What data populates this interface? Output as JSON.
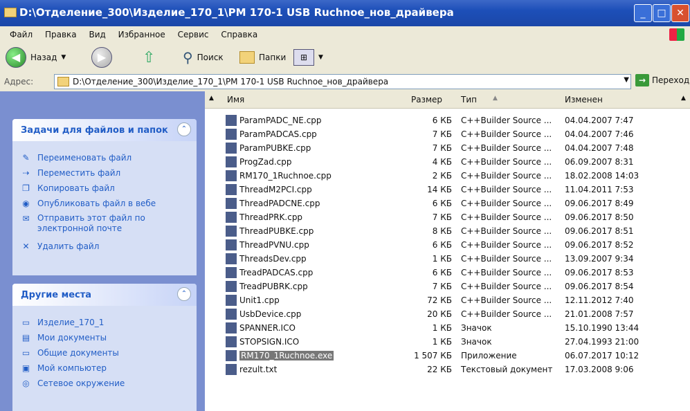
{
  "window": {
    "title": "D:\\Отделение_300\\Изделие_170_1\\РМ 170-1 USB Ruchnoe_нов_драйвера"
  },
  "menu": [
    "Файл",
    "Правка",
    "Вид",
    "Избранное",
    "Сервис",
    "Справка"
  ],
  "toolbar": {
    "back": "Назад",
    "search": "Поиск",
    "folders": "Папки"
  },
  "address": {
    "label": "Адрес:",
    "value": "D:\\Отделение_300\\Изделие_170_1\\РМ 170-1 USB Ruchnoe_нов_драйвера",
    "go": "Переход"
  },
  "tasks": {
    "title": "Задачи для файлов и папок",
    "items": [
      "Переименовать файл",
      "Переместить файл",
      "Копировать файл",
      "Опубликовать файл в вебе",
      "Отправить этот файл по электронной почте",
      "Удалить файл"
    ]
  },
  "places": {
    "title": "Другие места",
    "items": [
      "Изделие_170_1",
      "Мои документы",
      "Общие документы",
      "Мой компьютер",
      "Сетевое окружение"
    ]
  },
  "columns": {
    "name": "Имя",
    "size": "Размер",
    "type": "Тип",
    "modified": "Изменен"
  },
  "files": [
    {
      "name": "ParamPADC_NE.cpp",
      "size": "6 КБ",
      "type": "C++Builder Source ...",
      "modified": "04.04.2007 7:47"
    },
    {
      "name": "ParamPADCAS.cpp",
      "size": "7 КБ",
      "type": "C++Builder Source ...",
      "modified": "04.04.2007 7:46"
    },
    {
      "name": "ParamPUBKE.cpp",
      "size": "7 КБ",
      "type": "C++Builder Source ...",
      "modified": "04.04.2007 7:48"
    },
    {
      "name": "ProgZad.cpp",
      "size": "4 КБ",
      "type": "C++Builder Source ...",
      "modified": "06.09.2007 8:31"
    },
    {
      "name": "RM170_1Ruchnoe.cpp",
      "size": "2 КБ",
      "type": "C++Builder Source ...",
      "modified": "18.02.2008 14:03"
    },
    {
      "name": "ThreadM2PCI.cpp",
      "size": "14 КБ",
      "type": "C++Builder Source ...",
      "modified": "11.04.2011 7:53"
    },
    {
      "name": "ThreadPADCNE.cpp",
      "size": "6 КБ",
      "type": "C++Builder Source ...",
      "modified": "09.06.2017 8:49"
    },
    {
      "name": "ThreadPRK.cpp",
      "size": "7 КБ",
      "type": "C++Builder Source ...",
      "modified": "09.06.2017 8:50"
    },
    {
      "name": "ThreadPUBKE.cpp",
      "size": "8 КБ",
      "type": "C++Builder Source ...",
      "modified": "09.06.2017 8:51"
    },
    {
      "name": "ThreadPVNU.cpp",
      "size": "6 КБ",
      "type": "C++Builder Source ...",
      "modified": "09.06.2017 8:52"
    },
    {
      "name": "ThreadsDev.cpp",
      "size": "1 КБ",
      "type": "C++Builder Source ...",
      "modified": "13.09.2007 9:34"
    },
    {
      "name": "TreadPADCAS.cpp",
      "size": "6 КБ",
      "type": "C++Builder Source ...",
      "modified": "09.06.2017 8:53"
    },
    {
      "name": "TreadPUBRK.cpp",
      "size": "7 КБ",
      "type": "C++Builder Source ...",
      "modified": "09.06.2017 8:54"
    },
    {
      "name": "Unit1.cpp",
      "size": "72 КБ",
      "type": "C++Builder Source ...",
      "modified": "12.11.2012 7:40"
    },
    {
      "name": "UsbDevice.cpp",
      "size": "20 КБ",
      "type": "C++Builder Source ...",
      "modified": "21.01.2008 7:57"
    },
    {
      "name": "SPANNER.ICO",
      "size": "1 КБ",
      "type": "Значок",
      "modified": "15.10.1990 13:44"
    },
    {
      "name": "STOPSIGN.ICO",
      "size": "1 КБ",
      "type": "Значок",
      "modified": "27.04.1993 21:00"
    },
    {
      "name": "RM170_1Ruchnoe.exe",
      "size": "1 507 КБ",
      "type": "Приложение",
      "modified": "06.07.2017 10:12"
    },
    {
      "name": "rezult.txt",
      "size": "22 КБ",
      "type": "Текстовый документ",
      "modified": "17.03.2008 9:06"
    }
  ]
}
